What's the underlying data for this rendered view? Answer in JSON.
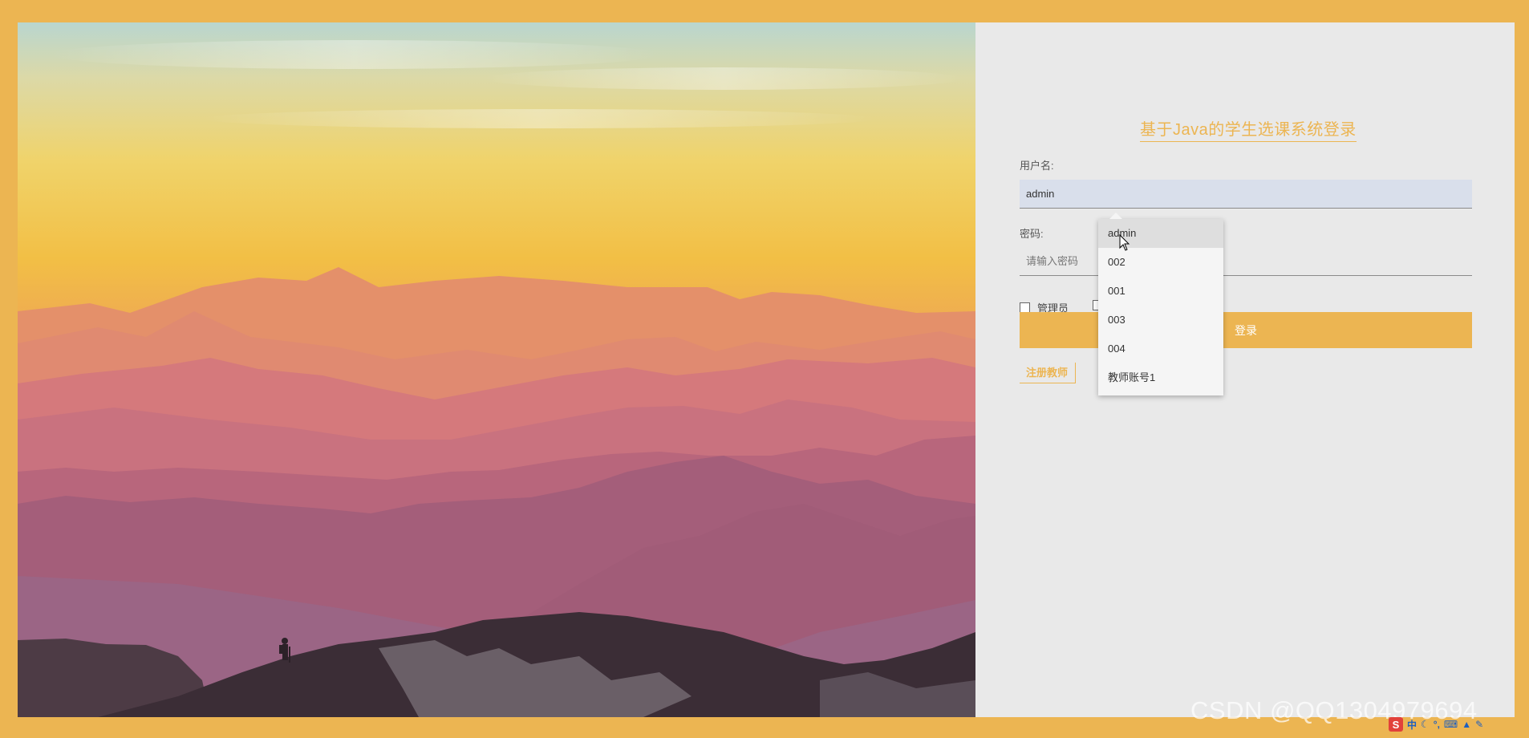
{
  "login": {
    "title": "基于Java的学生选课系统登录",
    "username_label": "用户名:",
    "username_value": "admin",
    "password_label": "密码:",
    "password_placeholder": "请输入密码",
    "roles": [
      "管理员"
    ],
    "login_button": "登录",
    "register_link": "注册教师"
  },
  "autocomplete": {
    "items": [
      "admin",
      "002",
      "001",
      "003",
      "004",
      "教师账号1"
    ],
    "highlighted_index": 0
  },
  "watermark": "CSDN @QQ1304979694",
  "tray": {
    "icons": [
      "sogou-ime-icon",
      "chinese-mode-icon",
      "moon-icon",
      "punctuation-icon",
      "keyboard-icon",
      "skin-icon",
      "settings-icon"
    ],
    "input_mode": "中"
  },
  "colors": {
    "accent": "#ECB552",
    "panel_bg": "#e9e9e9",
    "input_autofill": "#d9dfeb"
  }
}
